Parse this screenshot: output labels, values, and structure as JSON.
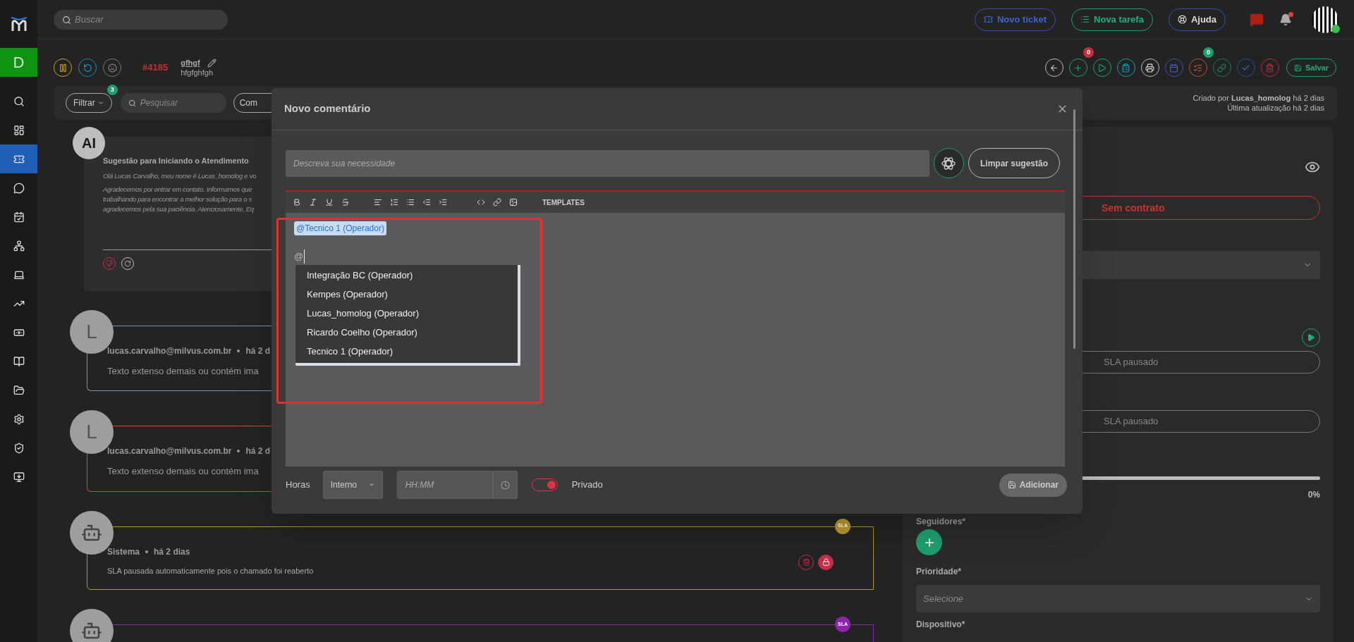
{
  "topbar": {
    "search_placeholder": "Buscar",
    "buttons": [
      {
        "kind": "ticket",
        "label": "Novo ticket"
      },
      {
        "kind": "task",
        "label": "Nova tarefa"
      },
      {
        "kind": "help",
        "label": "Ajuda"
      }
    ],
    "notifications_unread": true,
    "user_online": true
  },
  "sidebar": {
    "workspace_initial": "D",
    "items": [
      {
        "kind": "search",
        "selected": false
      },
      {
        "kind": "dashboard",
        "selected": false
      },
      {
        "kind": "tickets",
        "selected": true
      },
      {
        "kind": "chat",
        "selected": false
      },
      {
        "kind": "calendar",
        "selected": false
      },
      {
        "kind": "tree",
        "selected": false
      },
      {
        "kind": "devices",
        "selected": false
      },
      {
        "kind": "reports",
        "selected": false
      },
      {
        "kind": "finance",
        "selected": false
      },
      {
        "kind": "knowledge",
        "selected": false
      },
      {
        "kind": "folders",
        "selected": false
      },
      {
        "kind": "settings",
        "selected": false
      },
      {
        "kind": "security",
        "selected": false
      },
      {
        "kind": "remote",
        "selected": false
      }
    ]
  },
  "ticket": {
    "number": "#4185",
    "title": "gfhgf",
    "subtitle": "hfgfghfgh",
    "status_icons": [
      {
        "kind": "pause"
      },
      {
        "kind": "reopen"
      },
      {
        "kind": "mood"
      }
    ],
    "actions": [
      {
        "kind": "back"
      },
      {
        "kind": "add",
        "badge": "0"
      },
      {
        "kind": "play"
      },
      {
        "kind": "clipboard"
      },
      {
        "kind": "print"
      },
      {
        "kind": "calendar"
      },
      {
        "kind": "tasks",
        "badge": "0"
      },
      {
        "kind": "link"
      },
      {
        "kind": "check"
      },
      {
        "kind": "delete"
      }
    ],
    "save_label": "Salvar",
    "created": "Criado por **Lucas_homolog** há 2 dias",
    "updated": "Última atualização há 2 dias"
  },
  "filters": {
    "filter_label": "Filtrar",
    "filter_count": "3",
    "search_placeholder": "Pesquisar",
    "button_partial": "Com"
  },
  "timeline": [
    {
      "kind": "ai",
      "avatar_label": "AI",
      "title": "Sugestão para Iniciando o Atendimento",
      "lines": [
        "Olá Lucas Carvalho, meu nome é Lucas_homolog e vo",
        "Agradecemos por entrar em contato. Informamos que",
        "trabalhando para encontrar a melhor solução para o s",
        "agradecemos pela sua paciência. Atenciosamente, Eq"
      ]
    },
    {
      "kind": "comment",
      "initial": "L",
      "author": "lucas.carvalho@milvus.com.br",
      "time": "há 2 d",
      "text": "Texto extenso demais ou contém ima",
      "color": "#7b90b4"
    },
    {
      "kind": "comment",
      "initial": "L",
      "author": "lucas.carvalho@milvus.com.br",
      "time": "há 2 d",
      "text": "Texto extenso demais ou contém ima",
      "color": "#c4532e"
    },
    {
      "kind": "system",
      "author": "Sistema",
      "time": "há 2 dias",
      "text": "SLA pausada automaticamente pois o chamado foi reaberto",
      "badge": "SLA",
      "color": "#b8952a"
    },
    {
      "kind": "system",
      "badge": "SLA",
      "color": "#8e24aa"
    }
  ],
  "details": {
    "contract": "Sem contrato",
    "sla_fields": [
      "SLA pausado",
      "SLA pausado"
    ],
    "progress": {
      "level": 0,
      "reading": "0%"
    },
    "followers_label": "Seguidores*",
    "priority_label": "Prioridade*",
    "priority_placeholder": "Selecione",
    "device_label": "Dispositivo*"
  },
  "modal": {
    "title": "Novo comentário",
    "suggestion_placeholder": "Descreva sua necessidade",
    "clear_label": "Limpar sugestão",
    "templates_label": "TEMPLATES",
    "mention": "@Tecnico 1 (Operador)",
    "typed": "@",
    "suggestions": [
      "Integração BC (Operador)",
      "Kempes (Operador)",
      "Lucas_homolog (Operador)",
      "Ricardo Coelho (Operador)",
      "Tecnico 1 (Operador)"
    ],
    "hours_label": "Horas",
    "hours_type": "Interno",
    "time_placeholder": "HH:MM",
    "private": {
      "on": true,
      "label": "Privado"
    },
    "submit_label": "Adicionar"
  }
}
